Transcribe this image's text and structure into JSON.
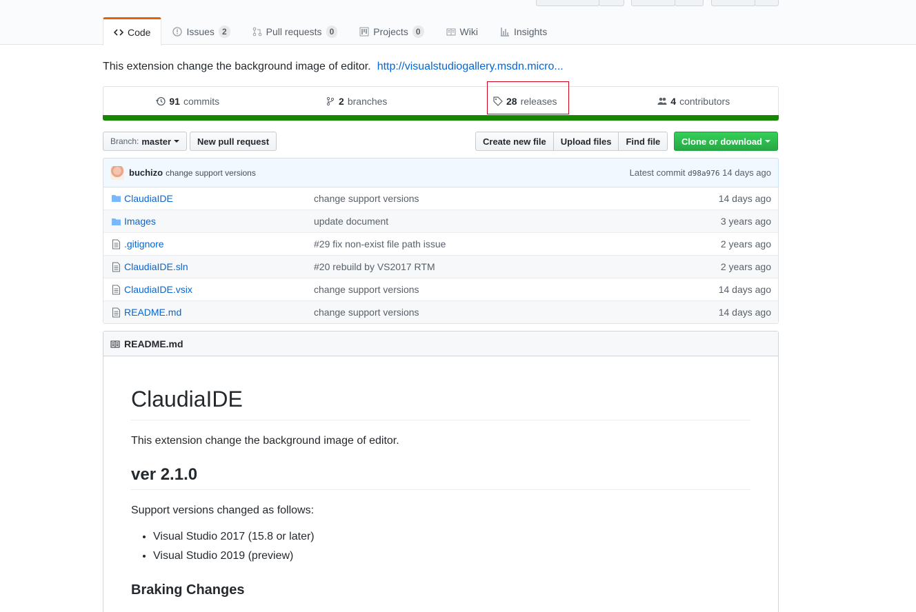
{
  "tabs": [
    {
      "label": "Code",
      "icon": "code-icon"
    },
    {
      "label": "Issues",
      "counter": "2",
      "icon": "issue-icon"
    },
    {
      "label": "Pull requests",
      "counter": "0",
      "icon": "pull-request-icon"
    },
    {
      "label": "Projects",
      "counter": "0",
      "icon": "project-icon"
    },
    {
      "label": "Wiki",
      "icon": "book-icon"
    },
    {
      "label": "Insights",
      "icon": "graph-icon"
    }
  ],
  "repo": {
    "description": "This extension change the background image of editor.",
    "homepage": "http://visualstudiogallery.msdn.micro..."
  },
  "summary": {
    "commits_count": "91",
    "commits_label": "commits",
    "branches_count": "2",
    "branches_label": "branches",
    "releases_count": "28",
    "releases_label": "releases",
    "contributors_count": "4",
    "contributors_label": "contributors"
  },
  "toolbar": {
    "branch_prefix": "Branch:",
    "branch_name": "master",
    "new_pr": "New pull request",
    "create_file": "Create new file",
    "upload_files": "Upload files",
    "find_file": "Find file",
    "clone": "Clone or download"
  },
  "latest_commit": {
    "author": "buchizo",
    "message": "change support versions",
    "prefix": "Latest commit",
    "sha": "d98a976",
    "age": "14 days ago"
  },
  "files": [
    {
      "type": "dir",
      "name": "ClaudiaIDE",
      "message": "change support versions",
      "age": "14 days ago"
    },
    {
      "type": "dir",
      "name": "Images",
      "message": "update document",
      "age": "3 years ago"
    },
    {
      "type": "file",
      "name": ".gitignore",
      "message": "#29 fix non-exist file path issue",
      "age": "2 years ago"
    },
    {
      "type": "file",
      "name": "ClaudiaIDE.sln",
      "message": "#20 rebuild by VS2017 RTM",
      "age": "2 years ago"
    },
    {
      "type": "file",
      "name": "ClaudiaIDE.vsix",
      "message": "change support versions",
      "age": "14 days ago"
    },
    {
      "type": "file",
      "name": "README.md",
      "message": "change support versions",
      "age": "14 days ago"
    }
  ],
  "readme": {
    "filename": "README.md",
    "h1": "ClaudiaIDE",
    "intro": "This extension change the background image of editor.",
    "h2": "ver 2.1.0",
    "support_text": "Support versions changed as follows:",
    "bullets": [
      "Visual Studio 2017 (15.8 or later)",
      "Visual Studio 2019 (preview)"
    ],
    "h3": "Braking Changes"
  },
  "colors": {
    "language_bar": "#178600",
    "highlight_box": "#d0021b",
    "primary_button": "#28a745"
  }
}
